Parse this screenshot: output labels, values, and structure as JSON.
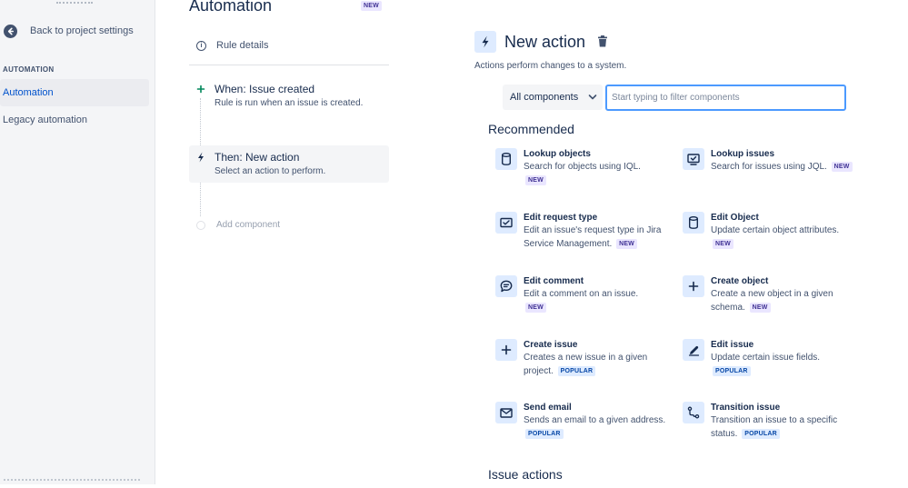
{
  "sidebar": {
    "back_label": "Back to project settings",
    "section_heading": "AUTOMATION",
    "items": [
      {
        "label": "Automation",
        "active": true
      },
      {
        "label": "Legacy automation",
        "active": false
      }
    ]
  },
  "header": {
    "title": "Automation",
    "badge": "NEW"
  },
  "rule": {
    "details_label": "Rule details",
    "steps": [
      {
        "title": "When: Issue created",
        "description": "Rule is run when an issue is created.",
        "icon": "plus-icon"
      },
      {
        "title": "Then: New action",
        "description": "Select an action to perform.",
        "icon": "lightning-icon"
      }
    ],
    "add_component_label": "Add component"
  },
  "panel": {
    "title": "New action",
    "description": "Actions perform changes to a system.",
    "filter": {
      "select_value": "All components",
      "placeholder": "Start typing to filter components",
      "value": ""
    },
    "recommended_heading": "Recommended",
    "issue_actions_heading": "Issue actions",
    "actions": [
      {
        "title": "Lookup objects",
        "description": "Search for objects using IQL.",
        "badge": "NEW",
        "icon": "cylinder-icon"
      },
      {
        "title": "Lookup issues",
        "description": "Search for issues using JQL.",
        "badge": "NEW",
        "icon": "monitor-check-icon"
      },
      {
        "title": "Edit request type",
        "description": "Edit an issue's request type in Jira Service Management.",
        "badge": "NEW",
        "icon": "request-type-icon"
      },
      {
        "title": "Edit Object",
        "description": "Update certain object attributes.",
        "badge": "NEW",
        "icon": "cylinder-icon"
      },
      {
        "title": "Edit comment",
        "description": "Edit a comment on an issue.",
        "badge": "NEW",
        "icon": "comment-icon"
      },
      {
        "title": "Create object",
        "description": "Create a new object in a given schema.",
        "badge": "NEW",
        "icon": "plus-icon"
      },
      {
        "title": "Create issue",
        "description": "Creates a new issue in a given project.",
        "badge": "POPULAR",
        "icon": "plus-icon"
      },
      {
        "title": "Edit issue",
        "description": "Update certain issue fields.",
        "badge": "POPULAR",
        "icon": "pencil-icon"
      },
      {
        "title": "Send email",
        "description": "Sends an email to a given address.",
        "badge": "POPULAR",
        "icon": "envelope-icon"
      },
      {
        "title": "Transition issue",
        "description": "Transition an issue to a specific status.",
        "badge": "POPULAR",
        "icon": "transition-icon"
      }
    ]
  },
  "colors": {
    "accent": "#0052cc",
    "icon_bg": "#deebff",
    "new_badge_bg": "#eae6ff",
    "new_badge_text": "#403294",
    "popular_badge_bg": "#deebff",
    "popular_badge_text": "#0747a6",
    "focus_border": "#4c9aff"
  }
}
